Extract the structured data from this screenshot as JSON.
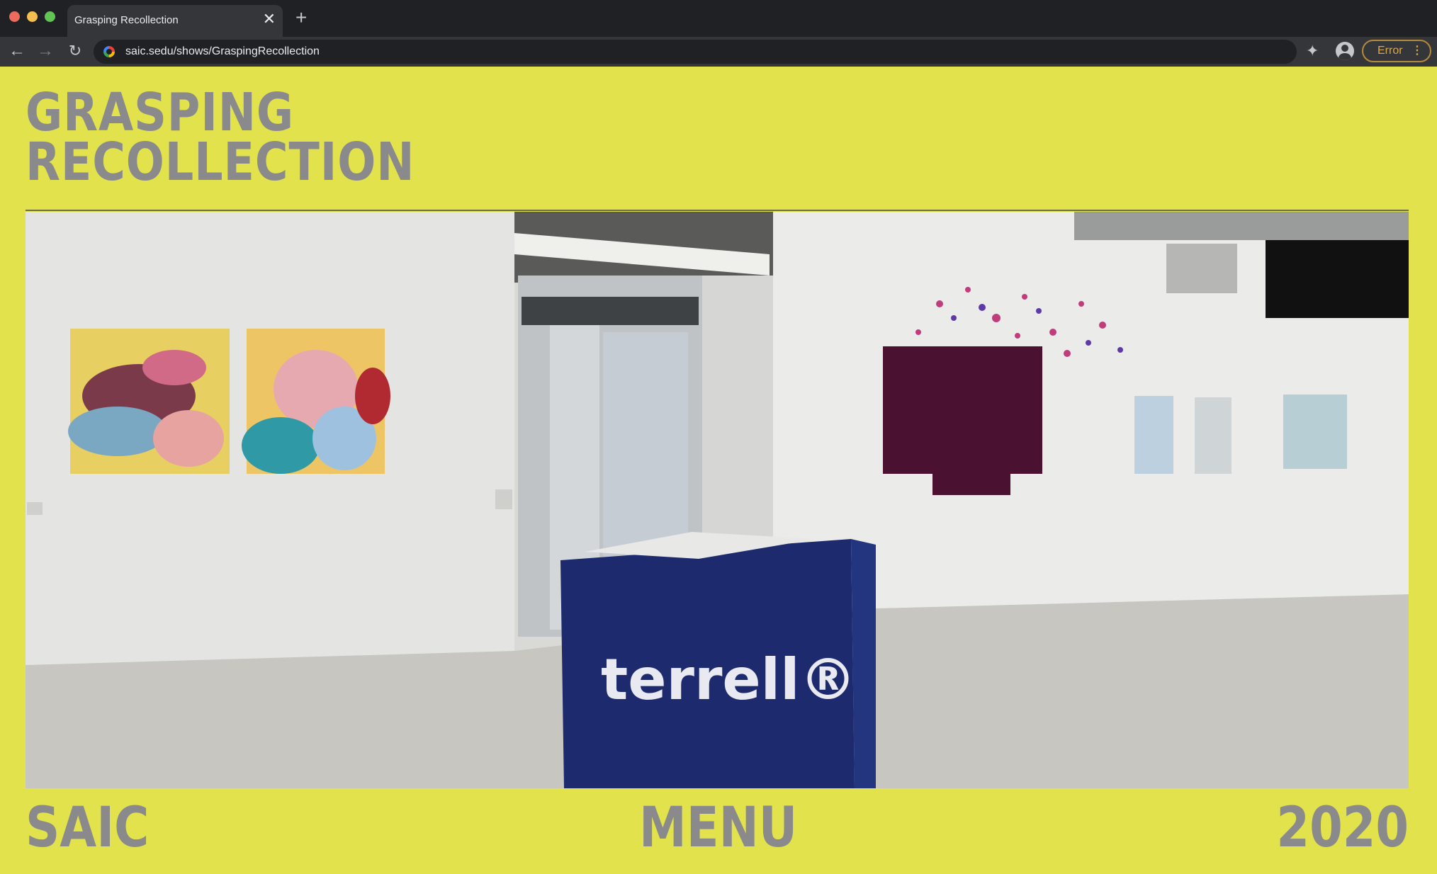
{
  "browser": {
    "tab_title": "Grasping Recollection",
    "tab_close_glyph": "✕",
    "new_tab_glyph": "+",
    "url": "saic.sedu/shows/GraspingRecollection",
    "status_pill_label": "Error",
    "status_pill_menu_glyph": "⋮",
    "icons": [
      "back-arrow-icon",
      "forward-arrow-icon",
      "reload-icon",
      "site-icon",
      "extensions-puzzle-icon",
      "profile-icon"
    ]
  },
  "page": {
    "title_line1": "GRASPING",
    "title_line2": "RECOLLECTION",
    "background_color": "#e1e24c",
    "text_color": "#8a8a8d",
    "hero_image": {
      "depicts": "gallery-installation-photo",
      "pedestal_logo": "terrell®"
    },
    "footer": {
      "left": "SAIC",
      "center": "MENU",
      "right": "2020"
    }
  }
}
